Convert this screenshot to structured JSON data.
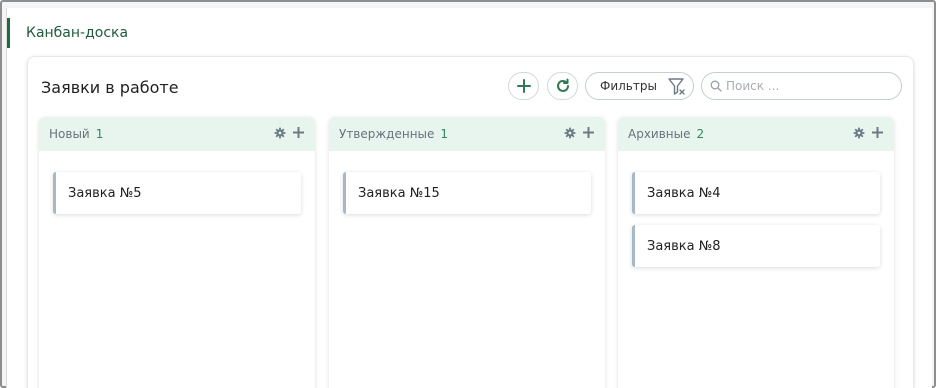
{
  "page": {
    "title": "Канбан-доска"
  },
  "board": {
    "title": "Заявки в работе",
    "filter_label": "Фильтры",
    "search_placeholder": "Поиск ..."
  },
  "columns": [
    {
      "name": "Новый",
      "count": "1",
      "cards": [
        "Заявка №5"
      ]
    },
    {
      "name": "Утвержденные",
      "count": "1",
      "cards": [
        "Заявка №15"
      ]
    },
    {
      "name": "Архивные",
      "count": "2",
      "cards": [
        "Заявка №4",
        "Заявка №8"
      ]
    }
  ],
  "colors": {
    "accent": "#1f6b45",
    "column_header_bg": "#e8f5ef",
    "count": "#2f8a5a",
    "card_border": "#a8b8c5"
  },
  "icons": {
    "add": "plus-icon",
    "refresh": "refresh-icon",
    "filter": "filter-clear-icon",
    "search": "search-icon",
    "settings": "gear-icon"
  }
}
